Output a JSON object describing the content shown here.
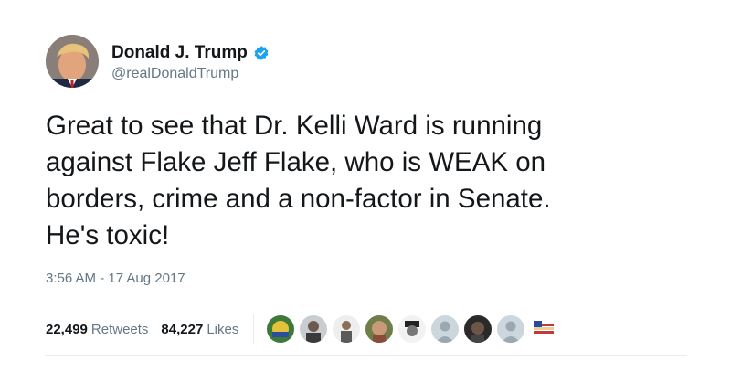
{
  "author": {
    "display_name": "Donald J. Trump",
    "handle": "@realDonaldTrump",
    "verified": true,
    "verified_icon": "verified-badge-icon"
  },
  "tweet": {
    "text": "Great to see that Dr. Kelli Ward is running\nagainst Flake Jeff Flake, who is WEAK on\nborders, crime and a non-factor in Senate.\nHe's toxic!",
    "timestamp": "3:56 AM - 17 Aug 2017"
  },
  "stats": {
    "retweets_count": "22,499",
    "retweets_label": "Retweets",
    "likes_count": "84,227",
    "likes_label": "Likes"
  },
  "colors": {
    "text_primary": "#14171a",
    "text_secondary": "#657786",
    "divider": "#e6ecf0",
    "verified": "#1da1f2"
  }
}
